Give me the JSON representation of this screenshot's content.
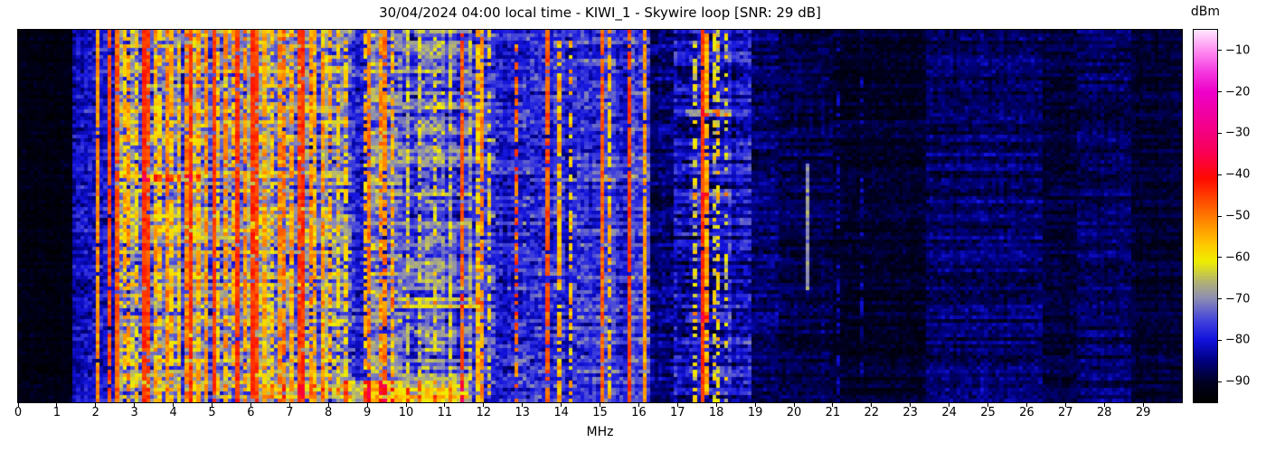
{
  "chart_data": {
    "type": "heatmap",
    "title": "30/04/2024 04:00 local time - KIWI_1 - Skywire loop [SNR: 29 dB]",
    "xlabel": "MHz",
    "x_range": [
      0,
      30
    ],
    "x_tick_values": [
      0,
      1,
      2,
      3,
      4,
      5,
      6,
      7,
      8,
      9,
      10,
      11,
      12,
      13,
      14,
      15,
      16,
      17,
      18,
      19,
      20,
      21,
      22,
      23,
      24,
      25,
      26,
      27,
      28,
      29
    ],
    "x_tick_labels": [
      "0",
      "1",
      "2",
      "3",
      "4",
      "5",
      "6",
      "7",
      "8",
      "9",
      "10",
      "11",
      "12",
      "13",
      "14",
      "15",
      "16",
      "17",
      "18",
      "19",
      "20",
      "21",
      "22",
      "23",
      "24",
      "25",
      "26",
      "27",
      "28",
      "29"
    ],
    "y_axis_ticks": "none (waterfall time axis, unlabeled)",
    "colorbar": {
      "label": "dBm",
      "min": -95,
      "max": -5,
      "tick_values": [
        -10,
        -20,
        -30,
        -40,
        -50,
        -60,
        -70,
        -80,
        -90
      ],
      "tick_labels": [
        "−10",
        "−20",
        "−30",
        "−40",
        "−50",
        "−60",
        "−70",
        "−80",
        "−90"
      ],
      "colormap_stops": [
        [
          0.0,
          "#000000"
        ],
        [
          0.05,
          "#00001e"
        ],
        [
          0.11,
          "#000080"
        ],
        [
          0.167,
          "#1212dc"
        ],
        [
          0.22,
          "#4444dc"
        ],
        [
          0.278,
          "#8c8cb4"
        ],
        [
          0.32,
          "#b0b078"
        ],
        [
          0.378,
          "#eeee00"
        ],
        [
          0.42,
          "#ffcc00"
        ],
        [
          0.5,
          "#ff7800"
        ],
        [
          0.555,
          "#ff3c00"
        ],
        [
          0.6,
          "#ff0a00"
        ],
        [
          0.667,
          "#fa0050"
        ],
        [
          0.722,
          "#f4007d"
        ],
        [
          0.833,
          "#ee00c8"
        ],
        [
          0.89,
          "#f43ce1"
        ],
        [
          0.944,
          "#ff8cf0"
        ],
        [
          1.0,
          "#ffe6fe"
        ]
      ]
    },
    "grid": {
      "cols": 300,
      "rows": 103
    },
    "seed": 20240430,
    "noise_bands": [
      {
        "from": 0.0,
        "to": 1.45,
        "base": -92.5,
        "noise": 2.2,
        "colvar": 0.5,
        "streak": 1.2
      },
      {
        "from": 1.45,
        "to": 1.95,
        "base": -81,
        "noise": 4.5,
        "colvar": 2,
        "streak": 2.5
      },
      {
        "from": 1.95,
        "to": 2.5,
        "base": -80,
        "noise": 5,
        "colvar": 3,
        "streak": 2.5
      },
      {
        "from": 2.5,
        "to": 8.6,
        "base": -70,
        "noise": 6.5,
        "colvar": 8,
        "streak": 5
      },
      {
        "from": 8.6,
        "to": 9.0,
        "base": -79,
        "noise": 5,
        "colvar": 3,
        "streak": 4
      },
      {
        "from": 9.0,
        "to": 9.9,
        "base": -73,
        "noise": 6,
        "colvar": 5,
        "streak": 5
      },
      {
        "from": 9.9,
        "to": 11.7,
        "base": -73.5,
        "noise": 6,
        "colvar": 5,
        "streak": 6
      },
      {
        "from": 11.7,
        "to": 12.3,
        "base": -76,
        "noise": 5.5,
        "colvar": 4,
        "streak": 4
      },
      {
        "from": 12.3,
        "to": 13.2,
        "base": -78.5,
        "noise": 5,
        "colvar": 3,
        "streak": 4
      },
      {
        "from": 13.2,
        "to": 14.4,
        "base": -78,
        "noise": 5,
        "colvar": 3,
        "streak": 4
      },
      {
        "from": 14.4,
        "to": 16.3,
        "base": -77,
        "noise": 5,
        "colvar": 3.5,
        "streak": 4
      },
      {
        "from": 16.3,
        "to": 16.9,
        "base": -86,
        "noise": 3.5,
        "colvar": 1.5,
        "streak": 3
      },
      {
        "from": 16.9,
        "to": 18.9,
        "base": -81.5,
        "noise": 4.5,
        "colvar": 3,
        "streak": 5.5
      },
      {
        "from": 18.9,
        "to": 19.6,
        "base": -86.5,
        "noise": 3,
        "colvar": 1.5,
        "streak": 3
      },
      {
        "from": 19.6,
        "to": 21.0,
        "base": -88.5,
        "noise": 2.8,
        "colvar": 1,
        "streak": 2.5
      },
      {
        "from": 21.0,
        "to": 23.4,
        "base": -90,
        "noise": 2.2,
        "colvar": 0.8,
        "streak": 2
      },
      {
        "from": 23.4,
        "to": 26.4,
        "base": -86.5,
        "noise": 3,
        "colvar": 1.2,
        "streak": 3
      },
      {
        "from": 26.4,
        "to": 27.3,
        "base": -89,
        "noise": 2.4,
        "colvar": 0.8,
        "streak": 2.2
      },
      {
        "from": 27.3,
        "to": 28.7,
        "base": -87,
        "noise": 2.8,
        "colvar": 1,
        "streak": 2.8
      },
      {
        "from": 28.7,
        "to": 30.0,
        "base": -89.5,
        "noise": 2.2,
        "colvar": 0.8,
        "streak": 2
      }
    ],
    "signal_lines": [
      {
        "f": 2.03,
        "level": -52,
        "duty": 0.95,
        "jitter": 4
      },
      {
        "f": 2.33,
        "level": -46,
        "duty": 0.9,
        "jitter": 4
      },
      {
        "f": 2.55,
        "level": -48,
        "duty": 0.9,
        "jitter": 4
      },
      {
        "f": 2.7,
        "level": -56,
        "duty": 0.7,
        "jitter": 5
      },
      {
        "f": 2.88,
        "level": -54,
        "duty": 0.7,
        "jitter": 5
      },
      {
        "f": 3.05,
        "level": -58,
        "duty": 0.6,
        "jitter": 5
      },
      {
        "f": 3.21,
        "level": -44,
        "duty": 0.95,
        "jitter": 3
      },
      {
        "f": 3.35,
        "level": -46,
        "duty": 0.9,
        "jitter": 4
      },
      {
        "f": 3.5,
        "level": -54,
        "duty": 0.7,
        "jitter": 5
      },
      {
        "f": 3.65,
        "level": -57,
        "duty": 0.6,
        "jitter": 5
      },
      {
        "f": 3.8,
        "level": -52,
        "duty": 0.8,
        "jitter": 5
      },
      {
        "f": 3.97,
        "level": -55,
        "duty": 0.7,
        "jitter": 5
      },
      {
        "f": 4.12,
        "level": -57,
        "duty": 0.6,
        "jitter": 5
      },
      {
        "f": 4.3,
        "level": -50,
        "duty": 0.8,
        "jitter": 5
      },
      {
        "f": 4.47,
        "level": -44,
        "duty": 0.95,
        "jitter": 3
      },
      {
        "f": 4.65,
        "level": -54,
        "duty": 0.7,
        "jitter": 5
      },
      {
        "f": 4.85,
        "level": -52,
        "duty": 0.8,
        "jitter": 5
      },
      {
        "f": 5.0,
        "level": -45,
        "duty": 0.95,
        "jitter": 3
      },
      {
        "f": 5.18,
        "level": -57,
        "duty": 0.6,
        "jitter": 5
      },
      {
        "f": 5.35,
        "level": -52,
        "duty": 0.7,
        "jitter": 5
      },
      {
        "f": 5.5,
        "level": -55,
        "duty": 0.7,
        "jitter": 5
      },
      {
        "f": 5.62,
        "level": -44,
        "duty": 0.95,
        "jitter": 3
      },
      {
        "f": 5.8,
        "level": -52,
        "duty": 0.8,
        "jitter": 5
      },
      {
        "f": 6.0,
        "level": -44,
        "duty": 0.95,
        "jitter": 3
      },
      {
        "f": 6.16,
        "level": -46,
        "duty": 0.9,
        "jitter": 4
      },
      {
        "f": 6.35,
        "level": -54,
        "duty": 0.7,
        "jitter": 5
      },
      {
        "f": 6.52,
        "level": -57,
        "duty": 0.6,
        "jitter": 5
      },
      {
        "f": 6.7,
        "level": -52,
        "duty": 0.8,
        "jitter": 5
      },
      {
        "f": 6.88,
        "level": -50,
        "duty": 0.8,
        "jitter": 5
      },
      {
        "f": 7.05,
        "level": -54,
        "duty": 0.7,
        "jitter": 5
      },
      {
        "f": 7.2,
        "level": -46,
        "duty": 0.9,
        "jitter": 4
      },
      {
        "f": 7.33,
        "level": -44,
        "duty": 0.95,
        "jitter": 3
      },
      {
        "f": 7.5,
        "level": -52,
        "duty": 0.8,
        "jitter": 5
      },
      {
        "f": 7.65,
        "level": -55,
        "duty": 0.7,
        "jitter": 5
      },
      {
        "f": 7.85,
        "level": -52,
        "duty": 0.7,
        "jitter": 5
      },
      {
        "f": 8.05,
        "level": -55,
        "duty": 0.6,
        "jitter": 5
      },
      {
        "f": 8.25,
        "level": -57,
        "duty": 0.6,
        "jitter": 5
      },
      {
        "f": 8.45,
        "level": -58,
        "duty": 0.6,
        "jitter": 5
      },
      {
        "f": 8.95,
        "level": -56,
        "duty": 0.6,
        "jitter": 5
      },
      {
        "f": 9.05,
        "level": -50,
        "duty": 0.85,
        "jitter": 4
      },
      {
        "f": 9.3,
        "level": -52,
        "duty": 0.7,
        "jitter": 5
      },
      {
        "f": 9.45,
        "level": -50,
        "duty": 0.8,
        "jitter": 5
      },
      {
        "f": 9.6,
        "level": -55,
        "duty": 0.7,
        "jitter": 5
      },
      {
        "f": 10.0,
        "level": -62,
        "duty": 0.5,
        "jitter": 6
      },
      {
        "f": 10.35,
        "level": -63,
        "duty": 0.5,
        "jitter": 6
      },
      {
        "f": 10.7,
        "level": -62,
        "duty": 0.5,
        "jitter": 6
      },
      {
        "f": 11.1,
        "level": -63,
        "duty": 0.5,
        "jitter": 6
      },
      {
        "f": 11.42,
        "level": -47,
        "duty": 0.9,
        "jitter": 4
      },
      {
        "f": 11.8,
        "level": -56,
        "duty": 0.7,
        "jitter": 5
      },
      {
        "f": 11.9,
        "level": -52,
        "duty": 0.8,
        "jitter": 5
      },
      {
        "f": 12.1,
        "level": -60,
        "duty": 0.5,
        "jitter": 6
      },
      {
        "f": 12.89,
        "level": -48,
        "duty": 0.55,
        "jitter": 6
      },
      {
        "f": 13.66,
        "level": -47,
        "duty": 0.9,
        "jitter": 4
      },
      {
        "f": 13.95,
        "level": -55,
        "duty": 0.75,
        "jitter": 5
      },
      {
        "f": 14.2,
        "level": -57,
        "duty": 0.5,
        "jitter": 6
      },
      {
        "f": 15.08,
        "level": -48,
        "duty": 0.9,
        "jitter": 4
      },
      {
        "f": 15.25,
        "level": -56,
        "duty": 0.6,
        "jitter": 5
      },
      {
        "f": 15.78,
        "level": -46,
        "duty": 0.92,
        "jitter": 4
      },
      {
        "f": 16.13,
        "level": -53,
        "duty": 0.9,
        "jitter": 4
      },
      {
        "f": 17.45,
        "level": -62,
        "duty": 0.45,
        "jitter": 6
      },
      {
        "f": 17.68,
        "level": -45,
        "duty": 0.95,
        "jitter": 3
      },
      {
        "f": 17.76,
        "level": -54,
        "duty": 0.8,
        "jitter": 5
      },
      {
        "f": 17.92,
        "level": -61,
        "duty": 0.45,
        "jitter": 6
      },
      {
        "f": 18.08,
        "level": -60,
        "duty": 0.45,
        "jitter": 6
      },
      {
        "f": 18.22,
        "level": -63,
        "duty": 0.4,
        "jitter": 6
      },
      {
        "f": 21.1,
        "level": -83,
        "duty": 0.35,
        "jitter": 3
      },
      {
        "f": 21.75,
        "level": -83,
        "duty": 0.3,
        "jitter": 3
      }
    ],
    "time_streaks": [
      {
        "rows": [
          97,
          102
        ],
        "f": [
          8.4,
          11.6
        ],
        "boost": 13
      },
      {
        "rows": [
          98,
          101
        ],
        "f": [
          6.4,
          8.4
        ],
        "boost": 6
      },
      {
        "rows": [
          40,
          41
        ],
        "f": [
          3.2,
          4.7
        ],
        "boost": 10
      },
      {
        "rows": [
          74,
          76
        ],
        "f": [
          9.5,
          12.0
        ],
        "boost": 7
      },
      {
        "rows": [
          22,
          23
        ],
        "f": [
          17.2,
          18.4
        ],
        "boost": 9
      },
      {
        "rows": [
          45,
          46
        ],
        "f": [
          17.2,
          18.4
        ],
        "boost": 8
      },
      {
        "rows": [
          78,
          80
        ],
        "f": [
          17.2,
          18.4
        ],
        "boost": 9
      },
      {
        "rows": [
          37,
          71
        ],
        "f": [
          20.3,
          20.42
        ],
        "boost": 19
      }
    ]
  }
}
